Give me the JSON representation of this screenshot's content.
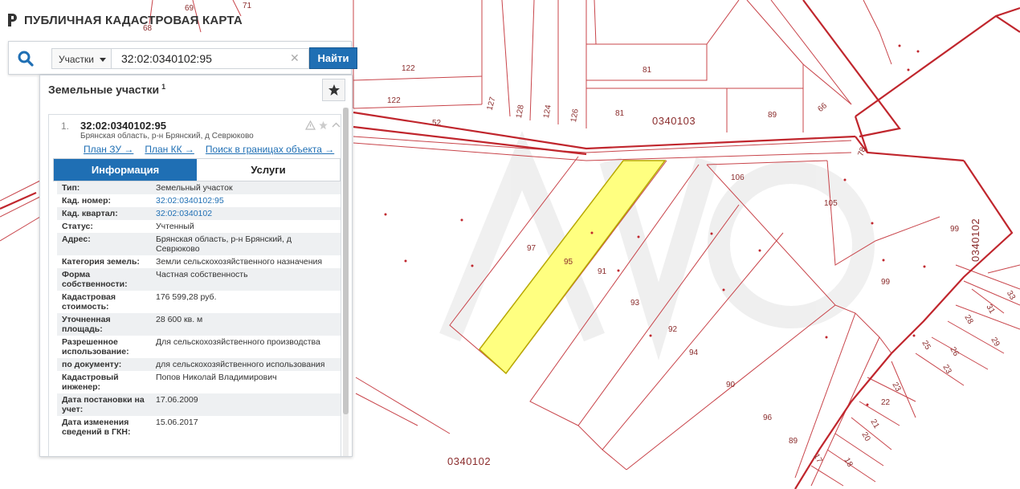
{
  "app": {
    "title": "ПУБЛИЧНАЯ КАДАСТРОВАЯ КАРТА"
  },
  "search": {
    "type_label": "Участки",
    "query": "32:02:0340102:95",
    "button_label": "Найти"
  },
  "panel": {
    "title": "Земельные участки",
    "count": "1"
  },
  "result": {
    "index": "1.",
    "number": "32:02:0340102:95",
    "address_short": "Брянская область, р-н Брянский, д Севрюково",
    "links": [
      "План ЗУ →",
      "План КК →",
      "Поиск в границах объекта →"
    ],
    "tabs": [
      "Информация",
      "Услуги"
    ],
    "info": [
      {
        "key": "Тип:",
        "value": "Земельный участок"
      },
      {
        "key": "Кад. номер:",
        "value": "32:02:0340102:95"
      },
      {
        "key": "Кад. квартал:",
        "value": "32:02:0340102"
      },
      {
        "key": "Статус:",
        "value": "Учтенный"
      },
      {
        "key": "Адрес:",
        "value": "Брянская область, р-н Брянский, д Севрюково"
      },
      {
        "key": "Категория земель:",
        "value": "Земли сельскохозяйственного назначения"
      },
      {
        "key": "Форма собственности:",
        "value": "Частная собственность"
      },
      {
        "key": "Кадастровая стоимость:",
        "value": "176 599,28 руб."
      },
      {
        "key": "Уточненная площадь:",
        "value": "28 600 кв. м"
      },
      {
        "key": "Разрешенное использование:",
        "value": "Для сельскохозяйственного производства"
      },
      {
        "key": "по документу:",
        "value": "для сельскохозяйственного использования"
      },
      {
        "key": "Кадастровый инженер:",
        "value": "Попов Николай Владимирович"
      },
      {
        "key": "Дата постановки на учет:",
        "value": "17.06.2009"
      },
      {
        "key": "Дата изменения сведений в ГКН:",
        "value": "15.06.2017"
      }
    ]
  },
  "map": {
    "quarter_labels": [
      "0340103",
      "0340102",
      "0340102"
    ],
    "plot_labels": [
      "69",
      "71",
      "68",
      "122",
      "122",
      "81",
      "81",
      "89",
      "66",
      "127",
      "128",
      "124",
      "126",
      "52",
      "78",
      "106",
      "105",
      "97",
      "95",
      "91",
      "93",
      "92",
      "94",
      "90",
      "96",
      "89",
      "99",
      "99",
      "33",
      "31",
      "28",
      "29",
      "25",
      "26",
      "23",
      "23",
      "22",
      "21",
      "20",
      "17",
      "18"
    ],
    "colors": {
      "boundary": "#c0262d",
      "parcel_line": "#c8444a",
      "selected_fill": "#ffff80",
      "selected_stroke": "#b8a800",
      "accent": "#1f6fb4"
    }
  }
}
